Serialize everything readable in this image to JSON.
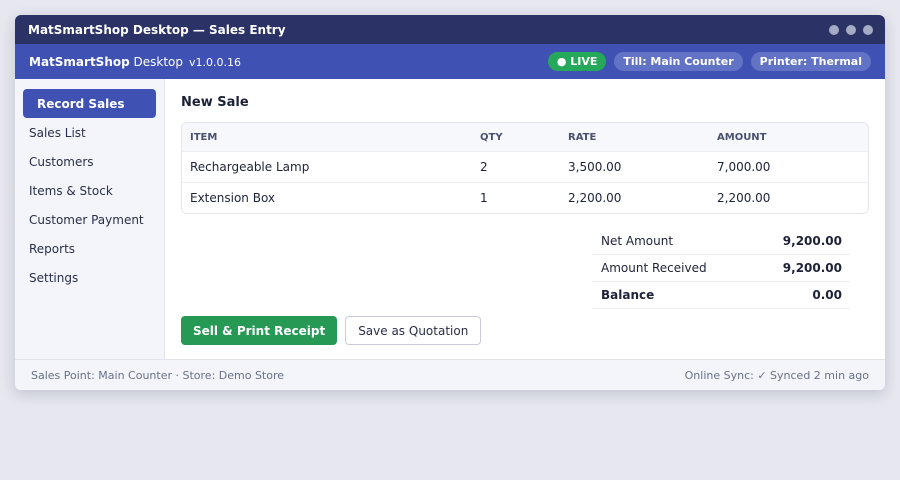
{
  "window": {
    "title": "MatSmartShop Desktop — Sales Entry"
  },
  "appbar": {
    "name_bold": "MatSmartShop",
    "name_rest": " Desktop",
    "version": "v1.0.0.16",
    "badges": {
      "live": "● LIVE",
      "till": "Till: Main Counter",
      "printer": "Printer: Thermal"
    }
  },
  "sidebar": {
    "items": [
      {
        "label": "Record Sales",
        "active": true
      },
      {
        "label": "Sales List"
      },
      {
        "label": "Customers"
      },
      {
        "label": "Items & Stock"
      },
      {
        "label": "Customer Payment"
      },
      {
        "label": "Reports"
      },
      {
        "label": "Settings"
      }
    ]
  },
  "main": {
    "title": "New Sale",
    "table": {
      "headers": {
        "item": "ITEM",
        "qty": "QTY",
        "rate": "RATE",
        "amount": "AMOUNT"
      },
      "rows": [
        {
          "item": "Rechargeable Lamp",
          "qty": "2",
          "rate": "3,500.00",
          "amount": "7,000.00"
        },
        {
          "item": "Extension Box",
          "qty": "1",
          "rate": "2,200.00",
          "amount": "2,200.00"
        }
      ]
    },
    "totals": {
      "net_label": "Net Amount",
      "net_value": "9,200.00",
      "received_label": "Amount Received",
      "received_value": "9,200.00",
      "balance_label": "Balance",
      "balance_value": "0.00"
    },
    "buttons": {
      "sell": "Sell & Print Receipt",
      "quote": "Save as Quotation"
    }
  },
  "footer": {
    "left": "Sales Point: Main Counter · Store: Demo Store",
    "right": "Online Sync: ✓ Synced 2 min ago"
  },
  "colors": {
    "accent": "#3f52b3",
    "titlebar": "#2a3266",
    "success": "#269a55"
  }
}
